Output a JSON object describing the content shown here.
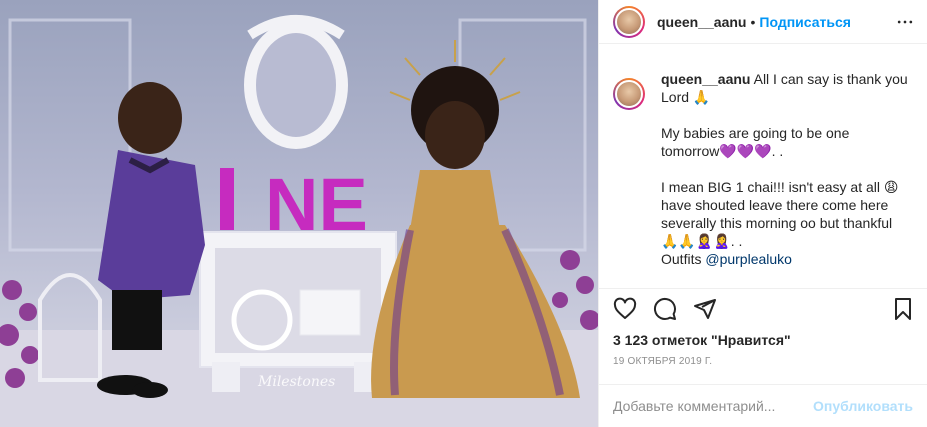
{
  "photo": {
    "alt": "",
    "watermark": "Milestones",
    "sign_text": "NE"
  },
  "header": {
    "username": "queen__aanu",
    "separator": "•",
    "follow_label": "Подписаться",
    "more_icon": "more-horizontal-icon"
  },
  "caption": {
    "username": "queen__aanu",
    "line1": "All I can say is thank you Lord 🙏",
    "line2": "My babies are going to be one tomorrow💜💜💜. .",
    "line3": "I mean BIG 1 chai!!! isn't easy at all 😩 have shouted leave there come here severally this morning oo but thankful 🙏🙏🙎‍♀️🙎‍♀️. .",
    "line4_prefix": "Outfits ",
    "mention": "@purplealuko"
  },
  "actions": {
    "like_icon": "heart-icon",
    "comment_icon": "comment-icon",
    "share_icon": "share-icon",
    "save_icon": "bookmark-icon"
  },
  "likes_text": "3 123 отметок \"Нравится\"",
  "date_text": "19 ОКТЯБРЯ 2019 Г.",
  "comment_box": {
    "placeholder": "Добавьте комментарий...",
    "publish_label": "Опубликовать"
  },
  "colors": {
    "accent": "#0095f6",
    "publish_disabled": "#b2dffc",
    "muted": "#8e8e8e",
    "mention": "#00376b"
  }
}
